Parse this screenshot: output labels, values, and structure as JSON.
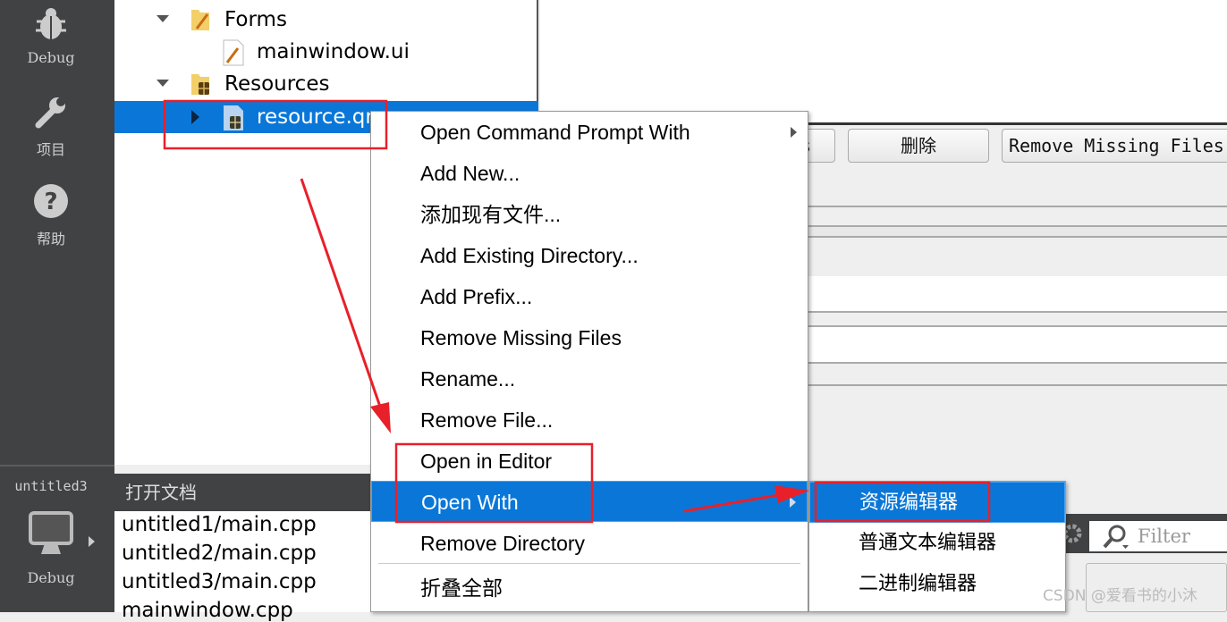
{
  "sidebar": {
    "debug_label": "Debug",
    "project_label": "项目",
    "help_label": "帮助",
    "kit_name": "untitled3",
    "kit_mode": "Debug"
  },
  "tree": {
    "forms": "Forms",
    "mainwindow_ui": "mainwindow.ui",
    "resources": "Resources",
    "resource_qrc": "resource.qr"
  },
  "toolbar": {
    "delete_label": "删除",
    "remove_missing_label": "Remove Missing Files",
    "partial_label": "s"
  },
  "open_docs": {
    "title": "打开文档",
    "items": [
      "untitled1/main.cpp",
      "untitled2/main.cpp",
      "untitled3/main.cpp",
      "mainwindow.cpp"
    ]
  },
  "context_menu": {
    "items": [
      "Open Command Prompt With",
      "Add New...",
      "添加现有文件...",
      "Add Existing Directory...",
      "Add Prefix...",
      "Remove Missing Files",
      "Rename...",
      "Remove File...",
      "Open in Editor",
      "Open With",
      "Remove Directory",
      "折叠全部"
    ],
    "highlighted": "Open With"
  },
  "submenu": {
    "items": [
      "资源编辑器",
      "普通文本编辑器",
      "二进制编辑器"
    ],
    "highlighted": "资源编辑器"
  },
  "filter": {
    "placeholder": "Filter"
  },
  "watermark": "CSDN @爱看书的小沐",
  "colors": {
    "selection": "#0a77d8",
    "sidebar": "#404244",
    "annotation": "#e8202a"
  }
}
